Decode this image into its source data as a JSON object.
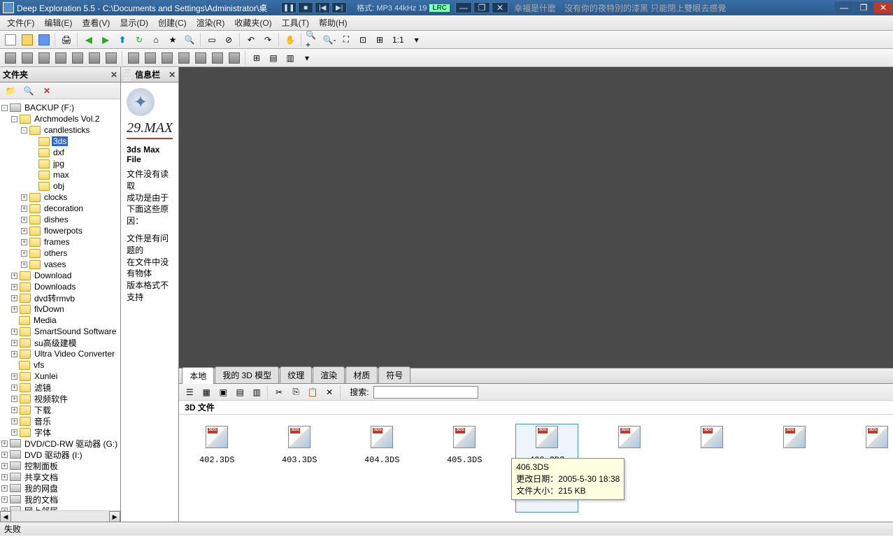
{
  "titlebar": {
    "app_title": "Deep Exploration 5.5 - C:\\Documents and Settings\\Administrator\\桌",
    "format_text": "格式: MP3 44kHz 19",
    "lrc": "LRC",
    "marquee": "幸福是什麼　沒有你的夜特別的漆黑 只能閉上雙眼去感覺"
  },
  "menu": {
    "items": [
      "文件(F)",
      "编辑(E)",
      "查看(V)",
      "显示(D)",
      "创建(C)",
      "渲染(R)",
      "收藏夹(O)",
      "工具(T)",
      "帮助(H)"
    ]
  },
  "toolbar1": {
    "ratio": "1:1"
  },
  "sidebar": {
    "title": "文件夹",
    "root": "BACKUP (F:)",
    "nodes": [
      {
        "label": "Archmodels Vol.2",
        "depth": 1,
        "exp": "-"
      },
      {
        "label": "candlesticks",
        "depth": 2,
        "exp": "-"
      },
      {
        "label": "3ds",
        "depth": 3,
        "sel": true
      },
      {
        "label": "dxf",
        "depth": 3
      },
      {
        "label": "jpg",
        "depth": 3
      },
      {
        "label": "max",
        "depth": 3
      },
      {
        "label": "obj",
        "depth": 3
      },
      {
        "label": "clocks",
        "depth": 2,
        "exp": "+"
      },
      {
        "label": "decoration",
        "depth": 2,
        "exp": "+"
      },
      {
        "label": "dishes",
        "depth": 2,
        "exp": "+"
      },
      {
        "label": "flowerpots",
        "depth": 2,
        "exp": "+"
      },
      {
        "label": "frames",
        "depth": 2,
        "exp": "+"
      },
      {
        "label": "others",
        "depth": 2,
        "exp": "+"
      },
      {
        "label": "vases",
        "depth": 2,
        "exp": "+"
      },
      {
        "label": "Download",
        "depth": 1,
        "exp": "+"
      },
      {
        "label": "Downloads",
        "depth": 1,
        "exp": "+"
      },
      {
        "label": "dvd转rmvb",
        "depth": 1,
        "exp": "+"
      },
      {
        "label": "flvDown",
        "depth": 1,
        "exp": "+"
      },
      {
        "label": "Media",
        "depth": 1
      },
      {
        "label": "SmartSound Software",
        "depth": 1,
        "exp": "+"
      },
      {
        "label": "su高级建模",
        "depth": 1,
        "exp": "+"
      },
      {
        "label": "Ultra Video Converter",
        "depth": 1,
        "exp": "+"
      },
      {
        "label": "vfs",
        "depth": 1
      },
      {
        "label": "Xunlei",
        "depth": 1,
        "exp": "+"
      },
      {
        "label": "滤镜",
        "depth": 1,
        "exp": "+"
      },
      {
        "label": "视频软件",
        "depth": 1,
        "exp": "+"
      },
      {
        "label": "下载",
        "depth": 1,
        "exp": "+"
      },
      {
        "label": "音乐",
        "depth": 1,
        "exp": "+"
      },
      {
        "label": "字体",
        "depth": 1,
        "exp": "+"
      }
    ],
    "drives": [
      "DVD/CD-RW 驱动器 (G:)",
      "DVD 驱动器 (I:)",
      "控制面板",
      "共享文档",
      "我的网盘",
      "我的文档",
      "网上邻居"
    ]
  },
  "info": {
    "title": "信息栏",
    "filename": "29.MAX",
    "filetype": "3ds Max File",
    "msg1": "文件没有读取",
    "msg2": "成功是由于",
    "msg3": "下面这些原因：",
    "msg4": "文件是有问题的",
    "msg5": "在文件中没有物体",
    "msg6": "版本格式不支持"
  },
  "tabs": [
    "本地",
    "我的 3D 模型",
    "纹理",
    "渲染",
    "材质",
    "符号"
  ],
  "btmtoolbar": {
    "search_label": "搜索:"
  },
  "files": {
    "header": "3D 文件",
    "items": [
      "402.3DS",
      "403.3DS",
      "404.3DS",
      "405.3DS",
      "406.3DS",
      "",
      "",
      "",
      ""
    ],
    "selected_index": 4
  },
  "tooltip": {
    "name": "406.3DS",
    "date_label": "更改日期：",
    "date": "2005-5-30 18:38",
    "size_label": "文件大小：",
    "size": "215 KB"
  },
  "status": "失败"
}
